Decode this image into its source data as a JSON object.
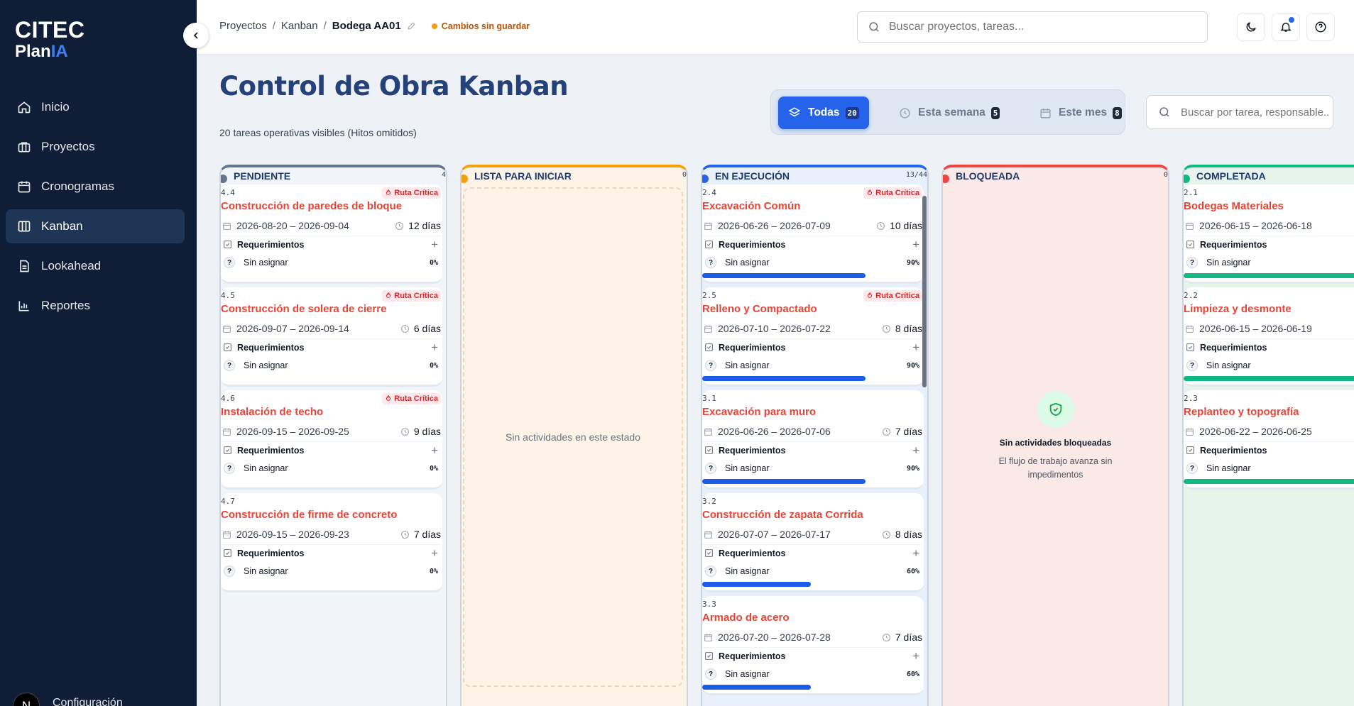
{
  "app": {
    "brand_line1": "CITEC",
    "brand_line2_a": "Plan",
    "brand_line2_b": "IA"
  },
  "sidebar": {
    "items": [
      {
        "label": "Inicio",
        "icon": "home-icon"
      },
      {
        "label": "Proyectos",
        "icon": "briefcase-icon"
      },
      {
        "label": "Cronogramas",
        "icon": "calendar-icon"
      },
      {
        "label": "Kanban",
        "icon": "kanban-icon",
        "active": true
      },
      {
        "label": "Lookahead",
        "icon": "document-icon"
      },
      {
        "label": "Reportes",
        "icon": "bar-chart-icon"
      }
    ],
    "avatar_letter": "N",
    "settings_label": "Configuración"
  },
  "topbar": {
    "breadcrumb": [
      "Proyectos",
      "Kanban",
      "Bodega AA01"
    ],
    "unsaved": "Cambios sin guardar",
    "search_placeholder": "Buscar proyectos, tareas..."
  },
  "header": {
    "title": "Control de Obra Kanban",
    "subtitle": "20 tareas operativas visibles (Hitos omitidos)",
    "filters": [
      {
        "label": "Todas",
        "count": "20",
        "active": true
      },
      {
        "label": "Esta semana",
        "count": "5"
      },
      {
        "label": "Este mes",
        "count": "8"
      }
    ],
    "task_search_placeholder": "Buscar por tarea, responsable..."
  },
  "board": {
    "columns": [
      {
        "name": "PENDIENTE",
        "count": "4",
        "color": "#64748b",
        "bg": "#f1f5f9",
        "cards": [
          {
            "id": "4.4",
            "title": "Construcción de paredes de bloque",
            "critical": "Ruta Crítica",
            "dates": "2026-08-20 – 2026-09-04",
            "duration": "12 días",
            "req": "Requerimientos",
            "assignee": "Sin asignar",
            "pct": "0%",
            "progress": 0
          },
          {
            "id": "4.5",
            "title": "Construcción de solera de cierre",
            "critical": "Ruta Crítica",
            "dates": "2026-09-07 – 2026-09-14",
            "duration": "6 días",
            "req": "Requerimientos",
            "assignee": "Sin asignar",
            "pct": "0%",
            "progress": 0
          },
          {
            "id": "4.6",
            "title": "Instalación de techo",
            "critical": "Ruta Crítica",
            "dates": "2026-09-15 – 2026-09-25",
            "duration": "9 días",
            "req": "Requerimientos",
            "assignee": "Sin asignar",
            "pct": "0%",
            "progress": 0
          },
          {
            "id": "4.7",
            "title": "Construcción de firme de concreto",
            "critical": "",
            "dates": "2026-09-15 – 2026-09-23",
            "duration": "7 días",
            "req": "Requerimientos",
            "assignee": "Sin asignar",
            "pct": "0%",
            "progress": 0
          }
        ]
      },
      {
        "name": "LISTA PARA INICIAR",
        "count": "0",
        "color": "#f59e0b",
        "bg": "#fdf3e6",
        "empty": "Sin actividades en este estado",
        "cards": []
      },
      {
        "name": "EN EJECUCIÓN",
        "count": "13/44",
        "color": "#2563eb",
        "bg": "#e8f0fc",
        "cards": [
          {
            "id": "2.4",
            "title": "Excavación Común",
            "critical": "Ruta Crítica",
            "dates": "2026-06-26 – 2026-07-09",
            "duration": "10 días",
            "req": "Requerimientos",
            "assignee": "Sin asignar",
            "pct": "90%",
            "progress": 0.9
          },
          {
            "id": "2.5",
            "title": "Relleno y Compactado",
            "critical": "Ruta Crítica",
            "dates": "2026-07-10 – 2026-07-22",
            "duration": "8 días",
            "req": "Requerimientos",
            "assignee": "Sin asignar",
            "pct": "90%",
            "progress": 0.9
          },
          {
            "id": "3.1",
            "title": "Excavación para muro",
            "critical": "",
            "dates": "2026-06-26 – 2026-07-06",
            "duration": "7 días",
            "req": "Requerimientos",
            "assignee": "Sin asignar",
            "pct": "90%",
            "progress": 0.9
          },
          {
            "id": "3.2",
            "title": "Construcción de zapata Corrida",
            "critical": "",
            "dates": "2026-07-07 – 2026-07-17",
            "duration": "8 días",
            "req": "Requerimientos",
            "assignee": "Sin asignar",
            "pct": "60%",
            "progress": 0.6
          },
          {
            "id": "3.3",
            "title": "Armado de acero",
            "critical": "",
            "dates": "2026-07-20 – 2026-07-28",
            "duration": "7 días",
            "req": "Requerimientos",
            "assignee": "Sin asignar",
            "pct": "60%",
            "progress": 0.6
          }
        ]
      },
      {
        "name": "BLOQUEADA",
        "count": "0",
        "color": "#ef4444",
        "bg": "#fbe9e8",
        "blocked_title": "Sin actividades bloqueadas",
        "blocked_desc": "El flujo de trabajo avanza sin impedimentos",
        "cards": []
      },
      {
        "name": "COMPLETADA",
        "count": "",
        "color": "#10b981",
        "bg": "#e6f4ec",
        "cards": [
          {
            "id": "2.1",
            "title": "Bodegas Materiales",
            "critical": "",
            "dates": "2026-06-15 – 2026-06-18",
            "duration": "",
            "req": "Requerimientos",
            "assignee": "Sin asignar",
            "pct": "",
            "progress": 1
          },
          {
            "id": "2.2",
            "title": "Limpieza y desmonte",
            "critical": "",
            "dates": "2026-06-15 – 2026-06-19",
            "duration": "",
            "req": "Requerimientos",
            "assignee": "Sin asignar",
            "pct": "",
            "progress": 1
          },
          {
            "id": "2.3",
            "title": "Replanteo y topografía",
            "critical": "",
            "dates": "2026-06-22 – 2026-06-25",
            "duration": "",
            "req": "Requerimientos",
            "assignee": "Sin asignar",
            "pct": "",
            "progress": 1
          }
        ]
      }
    ]
  }
}
